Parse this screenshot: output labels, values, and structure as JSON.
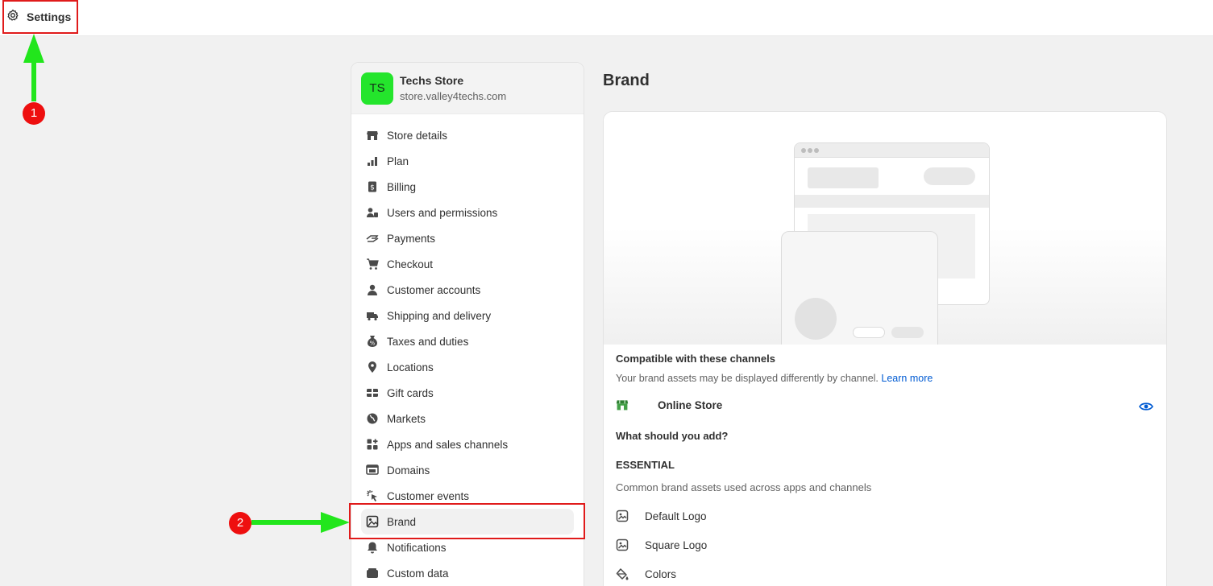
{
  "topbar": {
    "title": "Settings"
  },
  "store": {
    "initials": "TS",
    "name": "Techs Store",
    "url": "store.valley4techs.com",
    "avatar_color": "#24e52c"
  },
  "sidebar": {
    "items": [
      {
        "label": "Store details",
        "icon": "store-icon"
      },
      {
        "label": "Plan",
        "icon": "plan-icon"
      },
      {
        "label": "Billing",
        "icon": "billing-icon"
      },
      {
        "label": "Users and permissions",
        "icon": "users-icon"
      },
      {
        "label": "Payments",
        "icon": "payments-icon"
      },
      {
        "label": "Checkout",
        "icon": "cart-icon"
      },
      {
        "label": "Customer accounts",
        "icon": "person-icon"
      },
      {
        "label": "Shipping and delivery",
        "icon": "truck-icon"
      },
      {
        "label": "Taxes and duties",
        "icon": "tax-icon"
      },
      {
        "label": "Locations",
        "icon": "location-pin-icon"
      },
      {
        "label": "Gift cards",
        "icon": "gift-card-icon"
      },
      {
        "label": "Markets",
        "icon": "globe-icon"
      },
      {
        "label": "Apps and sales channels",
        "icon": "apps-icon"
      },
      {
        "label": "Domains",
        "icon": "domains-icon"
      },
      {
        "label": "Customer events",
        "icon": "cursor-icon"
      },
      {
        "label": "Brand",
        "icon": "brand-icon",
        "active": true
      },
      {
        "label": "Notifications",
        "icon": "bell-icon"
      },
      {
        "label": "Custom data",
        "icon": "custom-data-icon"
      }
    ]
  },
  "main": {
    "title": "Brand",
    "compatible_heading": "Compatible with these channels",
    "compatible_text": "Your brand assets may be displayed differently by channel.",
    "learn_more": "Learn more",
    "channel": {
      "name": "Online Store",
      "icon": "online-store-icon"
    },
    "what_heading": "What should you add?",
    "essential_heading": "ESSENTIAL",
    "essential_text": "Common brand assets used across apps and channels",
    "assets": [
      {
        "label": "Default Logo",
        "icon": "image-icon"
      },
      {
        "label": "Square Logo",
        "icon": "image-icon"
      },
      {
        "label": "Colors",
        "icon": "paint-bucket-icon"
      }
    ]
  },
  "annotations": [
    {
      "number": "1"
    },
    {
      "number": "2"
    }
  ],
  "colors": {
    "annotation_red": "#ee0f0f",
    "arrow_green": "#22e61c",
    "link_blue": "#005bd3"
  }
}
